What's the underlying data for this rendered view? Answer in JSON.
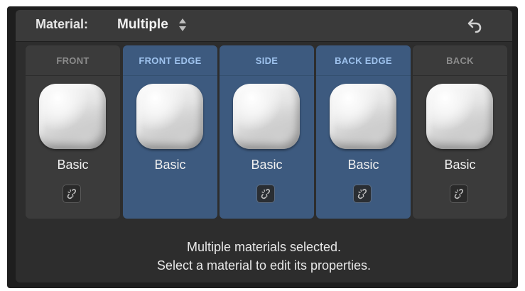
{
  "header": {
    "material_label": "Material:",
    "material_value": "Multiple"
  },
  "slots": [
    {
      "title": "FRONT",
      "material": "Basic",
      "selected": false,
      "has_link_button": true
    },
    {
      "title": "FRONT EDGE",
      "material": "Basic",
      "selected": true,
      "has_link_button": false
    },
    {
      "title": "SIDE",
      "material": "Basic",
      "selected": true,
      "has_link_button": true
    },
    {
      "title": "BACK EDGE",
      "material": "Basic",
      "selected": true,
      "has_link_button": true
    },
    {
      "title": "BACK",
      "material": "Basic",
      "selected": false,
      "has_link_button": true
    }
  ],
  "message": {
    "line1": "Multiple materials selected.",
    "line2": "Select a material to edit its properties."
  },
  "colors": {
    "selected_slot": "#3d5a7f",
    "unselected_slot": "#3b3b3b",
    "selected_title": "#9fc3ee"
  }
}
